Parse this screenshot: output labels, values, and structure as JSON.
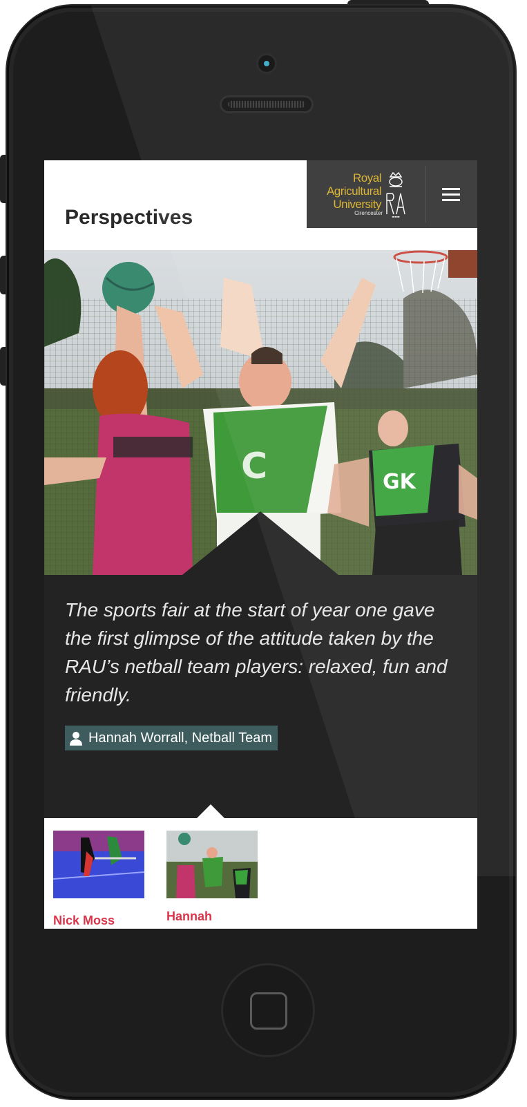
{
  "header": {
    "page_title": "Perspectives",
    "logo": {
      "line1": "Royal",
      "line2": "Agricultural",
      "line3": "University",
      "city": "Cirencester"
    },
    "menu_icon": "hamburger-icon"
  },
  "quote": {
    "text": "The sports fair at the start of year one gave the first glimpse of the attitude taken by the RAU’s netball team players: relaxed, fun and friendly.",
    "attribution": "Hannah Worrall, Netball Team",
    "attribution_icon": "person-icon"
  },
  "thumbnails": [
    {
      "name": "Nick Moss"
    },
    {
      "name": "Hannah"
    }
  ],
  "colors": {
    "accent_name": "#d9344a",
    "quote_bg": "#232323",
    "attribution_bg": "#3e5c5e",
    "logo_gold": "#d9b12a",
    "brand_box": "#353535"
  }
}
